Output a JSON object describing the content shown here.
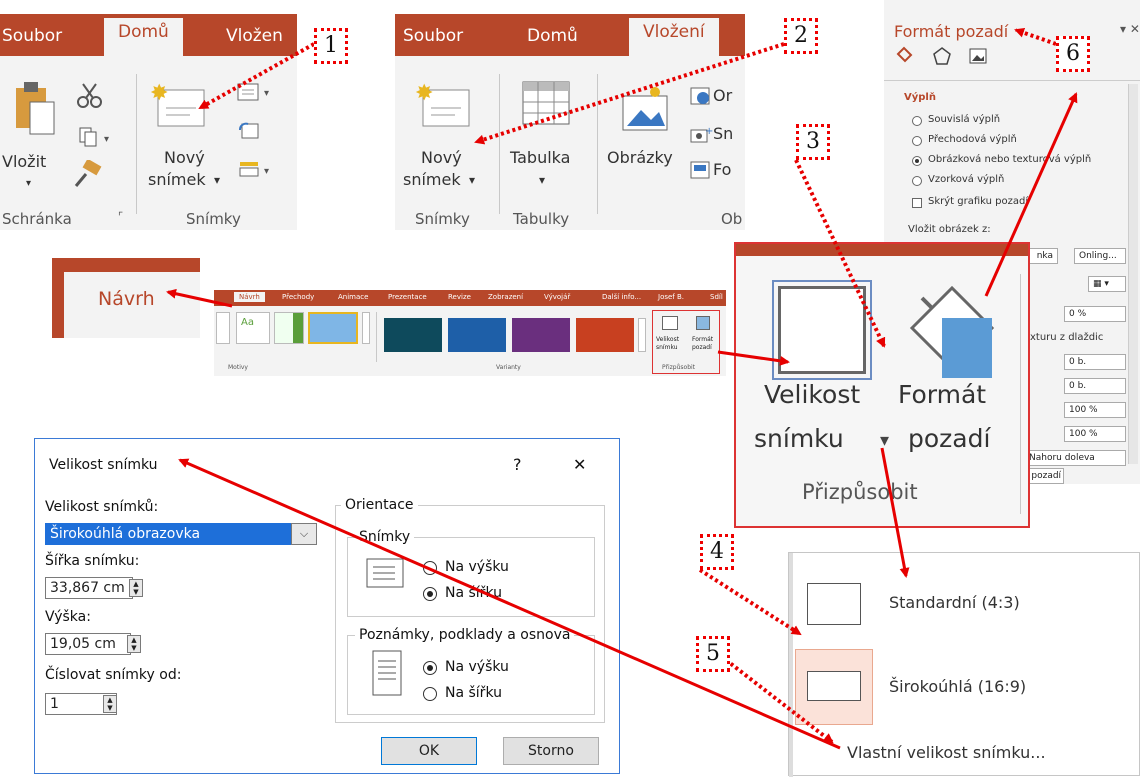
{
  "ribbon1": {
    "tabs": [
      "Soubor",
      "Domů",
      "Vložen"
    ],
    "paste_label": "Vložit",
    "new_slide_label": [
      "Nový",
      "snímek"
    ],
    "group_clipboard": "Schránka",
    "group_slides": "Snímky"
  },
  "ribbon2": {
    "tabs": [
      "Soubor",
      "Domů",
      "Vložení"
    ],
    "new_slide_label": [
      "Nový",
      "snímek"
    ],
    "table_label": "Tabulka",
    "pictures_label": "Obrázky",
    "side_items": [
      "Or",
      "Sn",
      "Fo"
    ],
    "group_slides": "Snímky",
    "group_tables": "Tabulky",
    "group_cut": "Ob"
  },
  "navrh": {
    "tab_label": "Návrh"
  },
  "mini_ribbon": {
    "tabs": [
      "Návrh",
      "Přechody",
      "Animace",
      "Prezentace",
      "Revize",
      "Zobrazení",
      "Vývojář",
      "Další info...",
      "Josef B.",
      "Sdíl"
    ],
    "size_label": [
      "Velikost",
      "snímku"
    ],
    "format_label": [
      "Formát",
      "pozadí"
    ],
    "group_themes": "Motivy",
    "group_variants": "Varianty",
    "group_customize": "Přizpůsobit"
  },
  "zoom_group": {
    "size_label": [
      "Velikost",
      "snímku"
    ],
    "format_label": [
      "Formát",
      "pozadí"
    ],
    "group_label": "Přizpůsobit"
  },
  "format_pane": {
    "title": "Formát pozadí",
    "section": "Výplň",
    "options": [
      "Souvislá výplň",
      "Přechodová výplň",
      "Obrázková nebo texturová výplň",
      "Vzorková výplň"
    ],
    "hide_graphics": "Skrýt grafiku pozadí",
    "insert_from": "Vložit obrázek z:",
    "file_button": "nka",
    "online_button": "Onling...",
    "transparency": "0 %",
    "tile_label": "exturu z dlaždic",
    "offsets": [
      "0 b.",
      "0 b.",
      "100 %",
      "100 %"
    ],
    "align": "Nahoru doleva",
    "reset": "t pozadí"
  },
  "dialog": {
    "title": "Velikost snímku",
    "help": "?",
    "close": "✕",
    "size_label": "Velikost snímků:",
    "size_value": "Širokoúhlá obrazovka",
    "width_label": "Šířka snímku:",
    "width_value": "33,867 cm",
    "height_label": "Výška:",
    "height_value": "19,05 cm",
    "number_label": "Číslovat snímky od:",
    "number_value": "1",
    "orientation": "Orientace",
    "slides_group": "Snímky",
    "slides_opts": [
      "Na výšku",
      "Na šířku"
    ],
    "notes_group": "Poznámky, podklady a osnova",
    "notes_opts": [
      "Na výšku",
      "Na šířku"
    ],
    "ok": "OK",
    "cancel": "Storno"
  },
  "menu": {
    "items": [
      "Standardní (4:3)",
      "Širokoúhlá (16:9)"
    ],
    "custom": "Vlastní velikost snímku..."
  },
  "callouts": [
    "1",
    "2",
    "3",
    "4",
    "5",
    "6"
  ],
  "colors": {
    "accent": "#b7472a",
    "arrow": "#e60000"
  }
}
